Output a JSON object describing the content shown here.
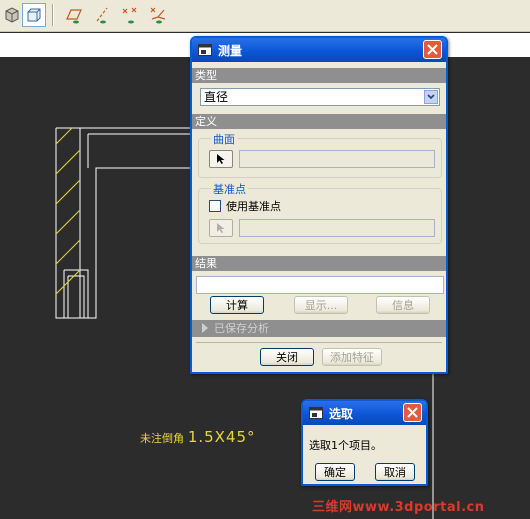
{
  "toolbar": {
    "tools": [
      {
        "icon": "cube-icon",
        "active": false
      },
      {
        "icon": "cube-outline-icon",
        "active": true
      },
      {
        "icon": "plane-display-icon",
        "active": false
      },
      {
        "icon": "axis-display-icon",
        "active": false
      },
      {
        "icon": "point-display-icon",
        "active": false
      },
      {
        "icon": "coordsys-display-icon",
        "active": false
      }
    ]
  },
  "drawing": {
    "annotation_small": "未注倒角",
    "annotation_value": "1.5X45°"
  },
  "measure_dialog": {
    "title": "测量",
    "type_label": "类型",
    "type_value": "直径",
    "definition_label": "定义",
    "surface_group": "曲面",
    "datum_group": "基准点",
    "use_datum_label": "使用基准点",
    "use_datum_checked": false,
    "result_label": "结果",
    "result_value": "",
    "compute_button": "计算",
    "display_button": "显示...",
    "info_button": "信息",
    "saved_analysis": "已保存分析",
    "close_button": "关闭",
    "add_feature_button": "添加特征"
  },
  "select_dialog": {
    "title": "选取",
    "message": "选取1个项目。",
    "ok_button": "确定",
    "cancel_button": "取消"
  },
  "watermark": "三维网www.3dportal.cn",
  "colors": {
    "background": "#2c2c2c",
    "drawing_lines": "#ffffff",
    "hatch": "#e8d63a",
    "titlebar": "#0a55d4",
    "window": "#ece9d8",
    "watermark": "#d93a2b"
  }
}
